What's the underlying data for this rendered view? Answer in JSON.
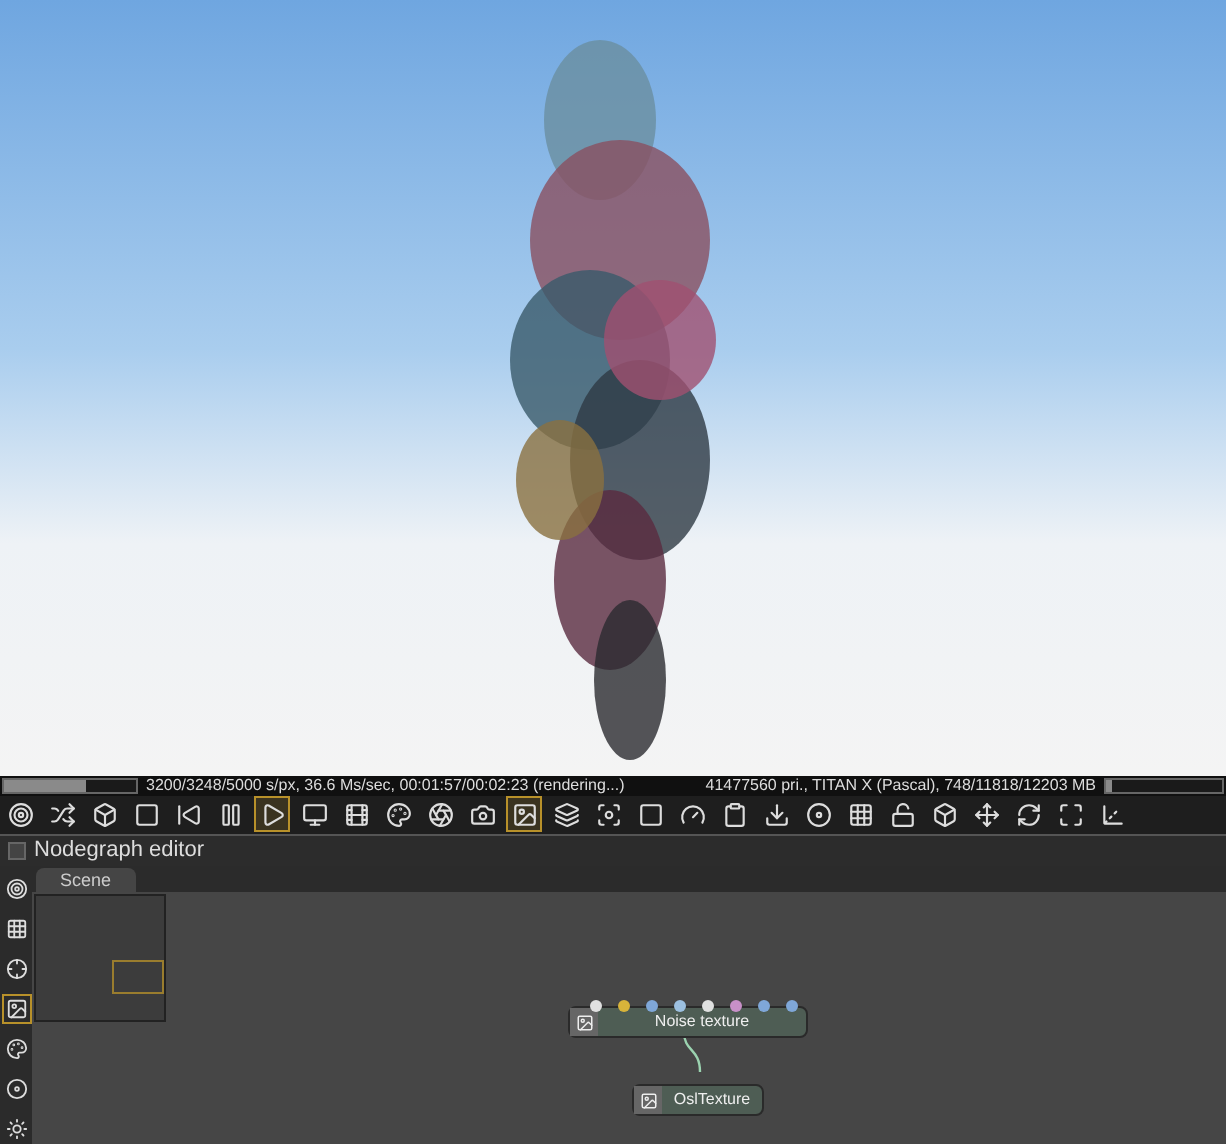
{
  "status_bar": {
    "left_progress": {
      "level": 0.62
    },
    "left_text": "3200/3248/5000 s/px, 36.6 Ms/sec, 00:01:57/00:02:23 (rendering...)",
    "right_text": "41477560 pri., TITAN X (Pascal), 748/11818/12203 MB",
    "right_progress": {
      "level": 0.05
    }
  },
  "toolbar": [
    {
      "selected": false
    },
    {
      "selected": false
    },
    {
      "selected": false
    },
    {
      "selected": false
    },
    {
      "selected": false
    },
    {
      "selected": false
    },
    {
      "selected": true
    },
    {
      "selected": false
    },
    {
      "selected": false
    },
    {
      "selected": false
    },
    {
      "selected": false
    },
    {
      "selected": false
    },
    {
      "selected": true
    },
    {
      "selected": false
    },
    {
      "selected": false
    },
    {
      "selected": false
    },
    {
      "selected": false
    },
    {
      "selected": false
    },
    {
      "selected": false
    },
    {
      "selected": false
    },
    {
      "selected": false
    },
    {
      "selected": false
    },
    {
      "selected": false
    },
    {
      "selected": false
    },
    {
      "selected": false
    },
    {
      "selected": false
    },
    {
      "selected": false
    }
  ],
  "nodegraph": {
    "title": "Nodegraph editor",
    "checked": false,
    "side_tools": [
      {
        "selected": false
      },
      {
        "selected": false
      },
      {
        "selected": false
      },
      {
        "selected": true
      },
      {
        "selected": false
      },
      {
        "selected": false
      },
      {
        "selected": false
      }
    ],
    "tabs": [
      {
        "label": "Scene",
        "selected": true
      }
    ],
    "nodes": [
      {
        "label": "Noise texture",
        "pins": [
          {
            "color": "#e0e0e0"
          },
          {
            "color": "#d8b43a"
          },
          {
            "color": "#7fa7d8"
          },
          {
            "color": "#9cc0e0"
          },
          {
            "color": "#e0e0e0"
          },
          {
            "color": "#c890c8"
          },
          {
            "color": "#7fa7d8"
          },
          {
            "color": "#7fa7d8"
          }
        ]
      },
      {
        "label": "OslTexture"
      }
    ]
  }
}
